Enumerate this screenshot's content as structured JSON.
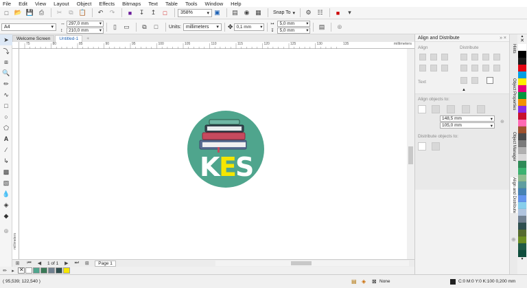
{
  "menu": [
    "File",
    "Edit",
    "View",
    "Layout",
    "Object",
    "Effects",
    "Bitmaps",
    "Text",
    "Table",
    "Tools",
    "Window",
    "Help"
  ],
  "toolbar": {
    "zoom": "358%",
    "snap_label": "Snap To"
  },
  "propbar": {
    "page_size": "A4",
    "width": "297,0 mm",
    "height": "210,0 mm",
    "units_label": "Units:",
    "units": "millimeters",
    "nudge": "0,1 mm",
    "dup_x": "5,0 mm",
    "dup_y": "5,0 mm"
  },
  "tabs": [
    {
      "label": "Welcome Screen"
    },
    {
      "label": "Untitled-1"
    }
  ],
  "ruler": {
    "unit": "millimeters",
    "h_ticks": [
      "75",
      "80",
      "85",
      "90",
      "95",
      "100",
      "105",
      "110",
      "115",
      "120",
      "125",
      "130",
      "135"
    ],
    "v_unit": "millimeters"
  },
  "logo": {
    "text_k": "K",
    "text_e": "E",
    "text_s": "S",
    "bg": "#4fa58d",
    "accent": "#f5e600"
  },
  "pages": {
    "counter": "1 of 1",
    "page_tab": "Page 1"
  },
  "docker": {
    "title": "Align and Distribute",
    "align": "Align",
    "distribute": "Distribute",
    "text": "Text",
    "align_to": "Align objects to:",
    "x_val": "148,5 mm",
    "y_val": "105,0 mm",
    "dist_to": "Distribute objects to:"
  },
  "sidetabs": [
    "Hints",
    "Object Properties",
    "Object Manager",
    "Align and Distribute"
  ],
  "status": {
    "coords": "( 95,539; 122,540 )",
    "fill": "None",
    "outline": "C:0 M:0 Y:0 K:100  0,200 mm"
  },
  "palette_colors": [
    "#ffffff",
    "#000000",
    "#1a1a1a",
    "#e30613",
    "#009fe3",
    "#ffed00",
    "#e5007d",
    "#00963f",
    "#f39200",
    "#8a2be2",
    "#c8102e",
    "#ff69b4",
    "#a0522d",
    "#4b4b4b",
    "#7a7a7a",
    "#b0b0b0",
    "#d8d8d8",
    "#2e8b57",
    "#3cb371",
    "#8fbc8f",
    "#5f9ea0",
    "#4682b4",
    "#6495ed",
    "#87ceeb",
    "#b0c4de",
    "#708090",
    "#2f4f4f",
    "#556b2f",
    "#6b8e23",
    "#1e5945",
    "#0e4d3c",
    "#3b7a57"
  ],
  "bottom_swatches": [
    "#ffffff",
    "#4fa58d",
    "#3b7a57",
    "#708090",
    "#2f4f4f",
    "#f5e600"
  ]
}
